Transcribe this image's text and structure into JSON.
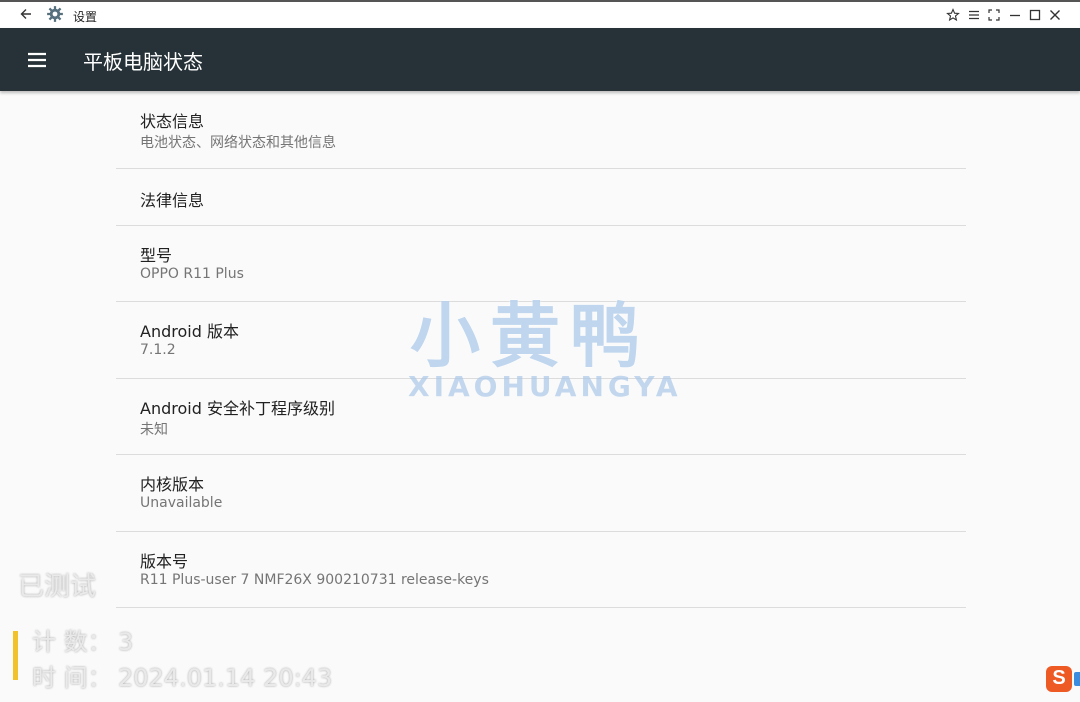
{
  "window": {
    "title": "设置"
  },
  "app_bar": {
    "title": "平板电脑状态"
  },
  "items": [
    {
      "title": "状态信息",
      "subtitle": "电池状态、网络状态和其他信息"
    },
    {
      "title": "法律信息"
    },
    {
      "title": "型号",
      "subtitle": "OPPO R11 Plus"
    },
    {
      "title": "Android 版本",
      "subtitle": "7.1.2"
    },
    {
      "title": "Android 安全补丁程序级别",
      "subtitle": "未知"
    },
    {
      "title": "内核版本",
      "subtitle": "Unavailable"
    },
    {
      "title": "版本号",
      "subtitle": "R11 Plus-user 7 NMF26X 900210731 release-keys"
    }
  ],
  "watermark": {
    "cn": "小黄鸭",
    "en": "XIAOHUANGYA"
  },
  "overlay": {
    "status": "已测试",
    "count_label": "计  数：",
    "count_value": "3",
    "time_label": "时  间：",
    "time_value": "2024.01.14 20:43"
  },
  "ime_badge": {
    "letter": "S"
  },
  "colors": {
    "app_bar": "#263238",
    "background": "#fafafa",
    "divider": "#dcdcdc",
    "overlay_accent": "#f2c22d",
    "watermark": "#aac8e8",
    "ime_badge": "#ee5a24"
  }
}
